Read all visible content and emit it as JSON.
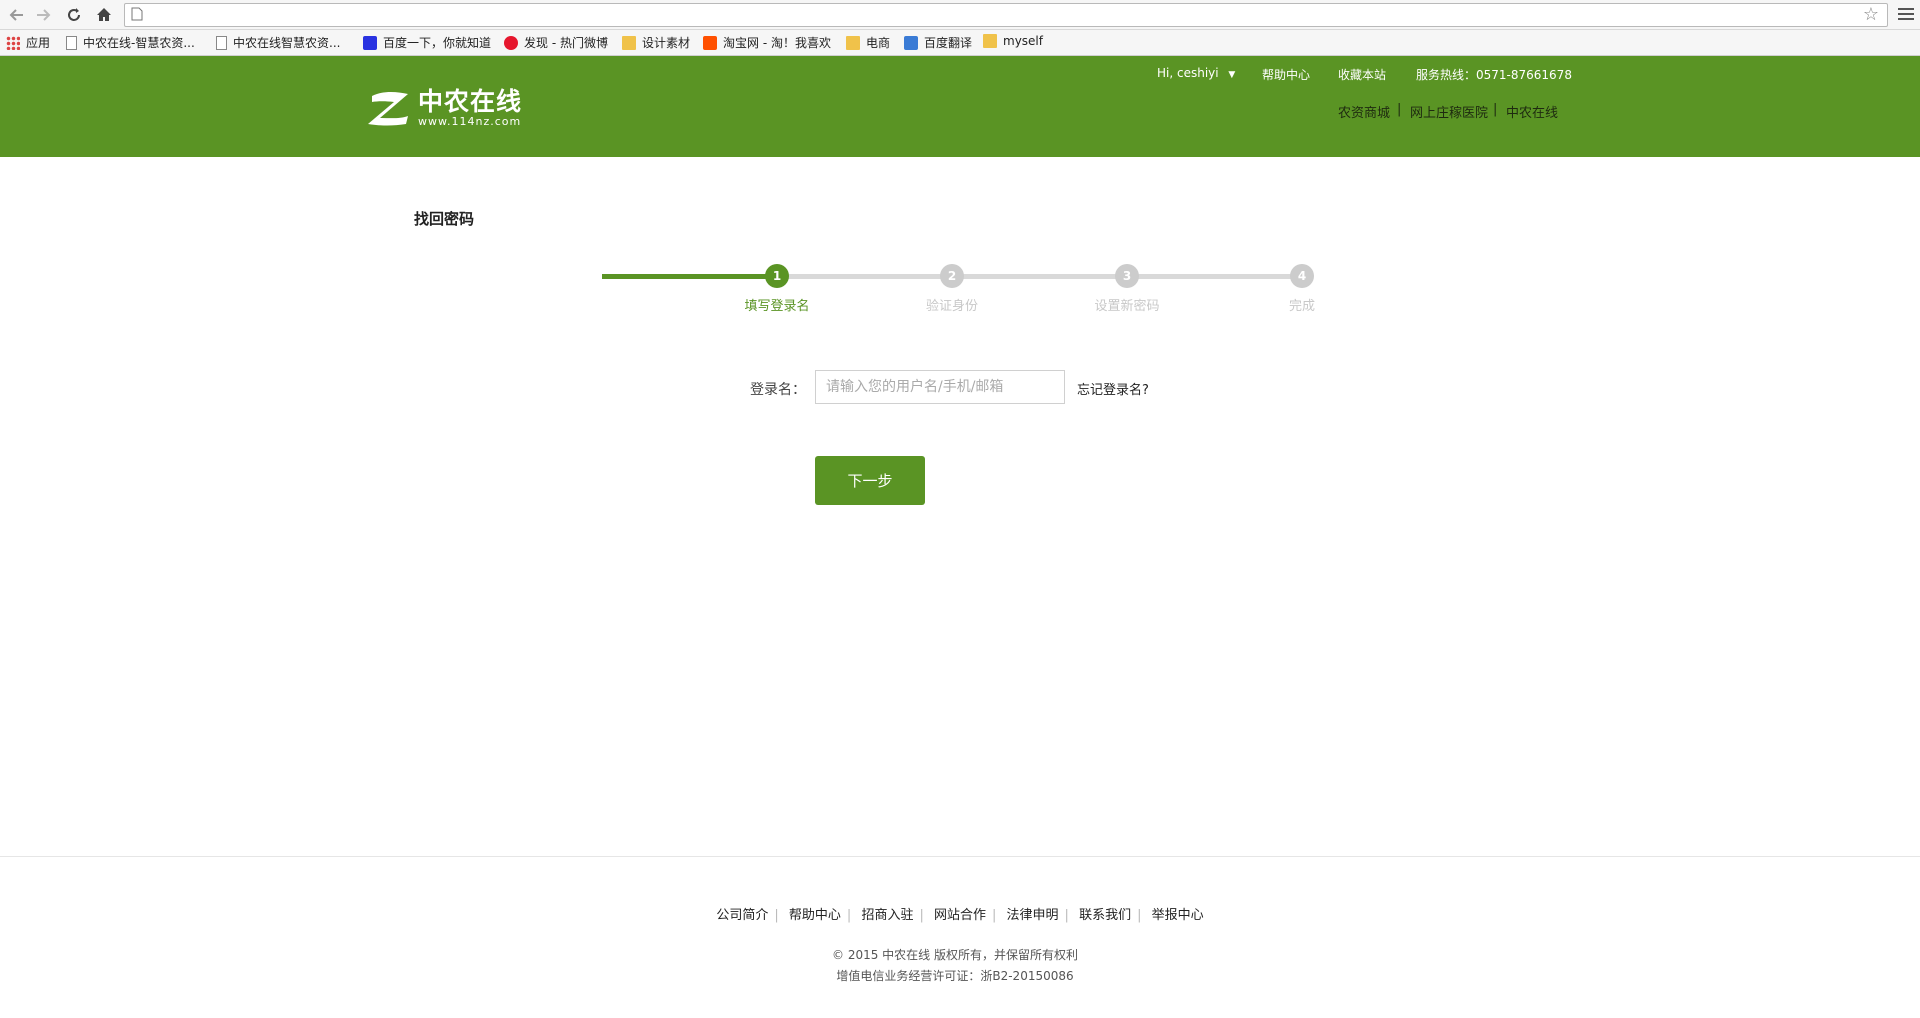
{
  "browser": {
    "url": "",
    "bookmarks": [
      {
        "label": "应用",
        "icon": "apps-grid-icon"
      },
      {
        "label": "中农在线-智慧农资...",
        "icon": "page-icon"
      },
      {
        "label": "中农在线智慧农资...",
        "icon": "page-icon"
      },
      {
        "label": "百度一下，你就知道",
        "icon": "baidu-paw-icon"
      },
      {
        "label": "发现 - 热门微博",
        "icon": "weibo-icon"
      },
      {
        "label": "设计素材",
        "icon": "folder-icon"
      },
      {
        "label": "淘宝网 - 淘！我喜欢",
        "icon": "taobao-icon"
      },
      {
        "label": "电商",
        "icon": "folder-icon"
      },
      {
        "label": "百度翻译",
        "icon": "baidu-translate-icon"
      },
      {
        "label": "myself",
        "icon": "folder-icon"
      }
    ]
  },
  "header": {
    "logo_name": "中农在线",
    "logo_url": "www.114nz.com",
    "user_greeting": "Hi, ceshiyi",
    "help": "帮助中心",
    "bookmark_site": "收藏本站",
    "hotline": "服务热线：0571-87661678",
    "sub_links": [
      "农资商城",
      "|",
      "网上庄稼医院",
      "|",
      "中农在线"
    ],
    "brand_color": "#5a9424"
  },
  "main": {
    "title": "找回密码",
    "steps": [
      {
        "num": "1",
        "label": "填写登录名",
        "active": true
      },
      {
        "num": "2",
        "label": "验证身份",
        "active": false
      },
      {
        "num": "3",
        "label": "设置新密码",
        "active": false
      },
      {
        "num": "4",
        "label": "完成",
        "active": false
      }
    ],
    "login_label": "登录名：",
    "login_placeholder": "请输入您的用户名/手机/邮箱",
    "login_value": "",
    "forgot": "忘记登录名?",
    "next_button": "下一步"
  },
  "footer": {
    "links": [
      "公司简介",
      "帮助中心",
      "招商入驻",
      "网站合作",
      "法律申明",
      "联系我们",
      "举报中心"
    ],
    "copyright": "© 2015  中农在线  版权所有，并保留所有权利",
    "license": "增值电信业务经营许可证：浙B2-20150086"
  }
}
